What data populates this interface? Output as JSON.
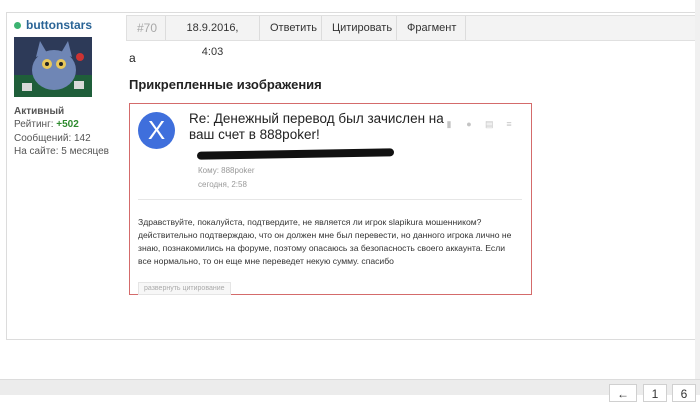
{
  "user": {
    "name": "buttonstars",
    "status": "Активный",
    "rating_label": "Рейтинг:",
    "rating_value": "+502",
    "messages": "Сообщений: 142",
    "on_site": "На сайте: 5 месяцев"
  },
  "post": {
    "number": "#70",
    "date": "18.9.2016, 4:03",
    "actions": [
      "Ответить",
      "Цитировать",
      "Фрагмент"
    ],
    "text": "а",
    "attachments_title": "Прикрепленные изображения"
  },
  "email": {
    "avatar_letter": "X",
    "subject": "Re: Денежный перевод был зачислен на ваш счет в 888poker!",
    "to": "Кому: 888poker",
    "date": "сегодня, 2:58",
    "body": "Здравствуйте, покалуйста, подтвердите, не является ли игрок slapikura мошенником? действительно подтверждаю, что он должен мне был перевести, но данного игрока лично не знаю, познакомились на форуме, поэтому опасаюсь за безопасность своего аккаунта. Если все нормально, то он еще мне переведет некую сумму. спасибо",
    "expand_button": "развернуть цитирование",
    "tool_icons": [
      "bookmark-icon",
      "dot-icon",
      "calendar-icon",
      "menu-icon"
    ]
  },
  "pager": {
    "prev": "←",
    "pages": [
      "1",
      "6"
    ]
  },
  "colors": {
    "username": "#2a6496",
    "online": "#3cb371",
    "rating": "#2e8b2e",
    "attachment_border": "#d46b6b",
    "avatar_circle": "#3f6fdc"
  }
}
